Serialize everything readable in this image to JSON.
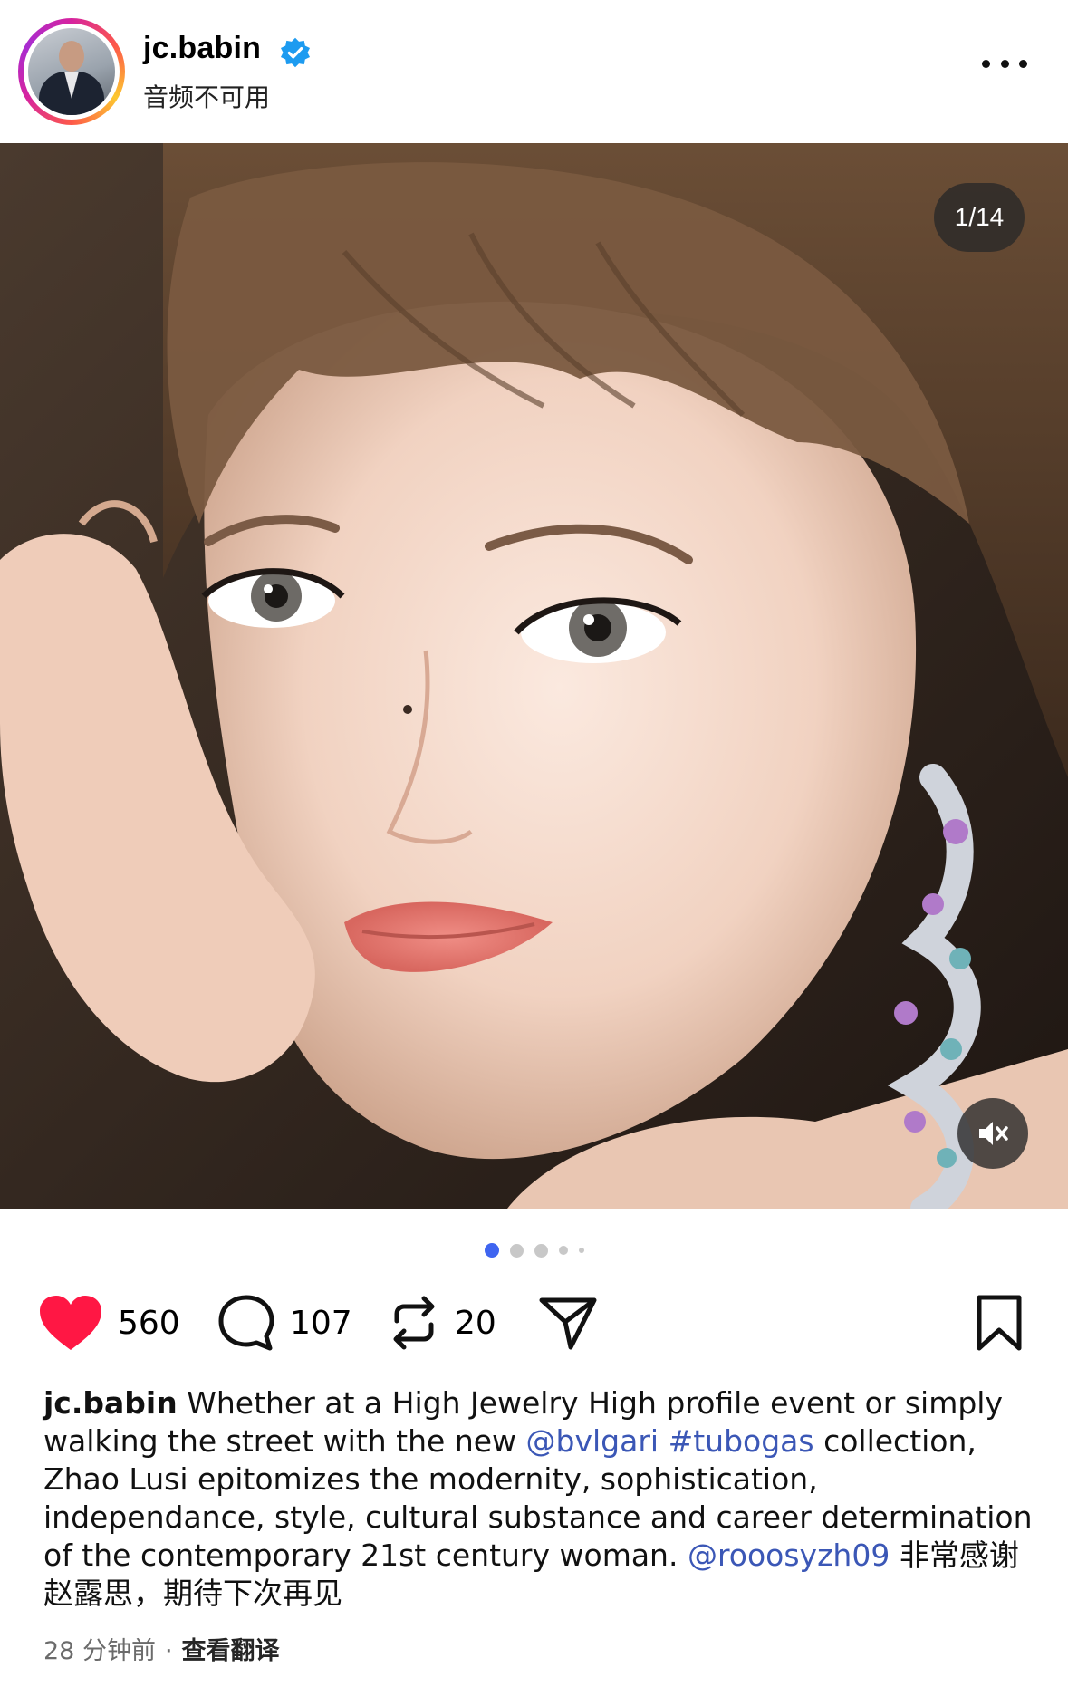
{
  "header": {
    "username": "jc.babin",
    "subtitle": "音频不可用"
  },
  "media": {
    "counter": "1/14",
    "carousel_dots": 5,
    "active_dot": 0,
    "muted": true
  },
  "actions": {
    "likes": "560",
    "comments": "107",
    "reposts": "20",
    "liked": true
  },
  "caption": {
    "user": "jc.babin",
    "text_1": " Whether at a High Jewelry High profile event or simply walking the street with the new ",
    "mention_1": "@bvlgari",
    "text_2": " ",
    "hashtag": "#tubogas",
    "text_3": " collection, Zhao Lusi epitomizes the modernity, sophistication, independance, style, cultural substance and career determination of the contemporary 21st century woman. ",
    "mention_2": "@rooosyzh09",
    "text_4": " 非常感谢赵露思，期待下次再见"
  },
  "footer": {
    "time": "28 分钟前",
    "separator": "·",
    "translate": "查看翻译"
  },
  "colors": {
    "like": "#ff1744",
    "link": "#3b57b6",
    "active_dot": "#3f65f0",
    "verified": "#1d9bf0"
  }
}
